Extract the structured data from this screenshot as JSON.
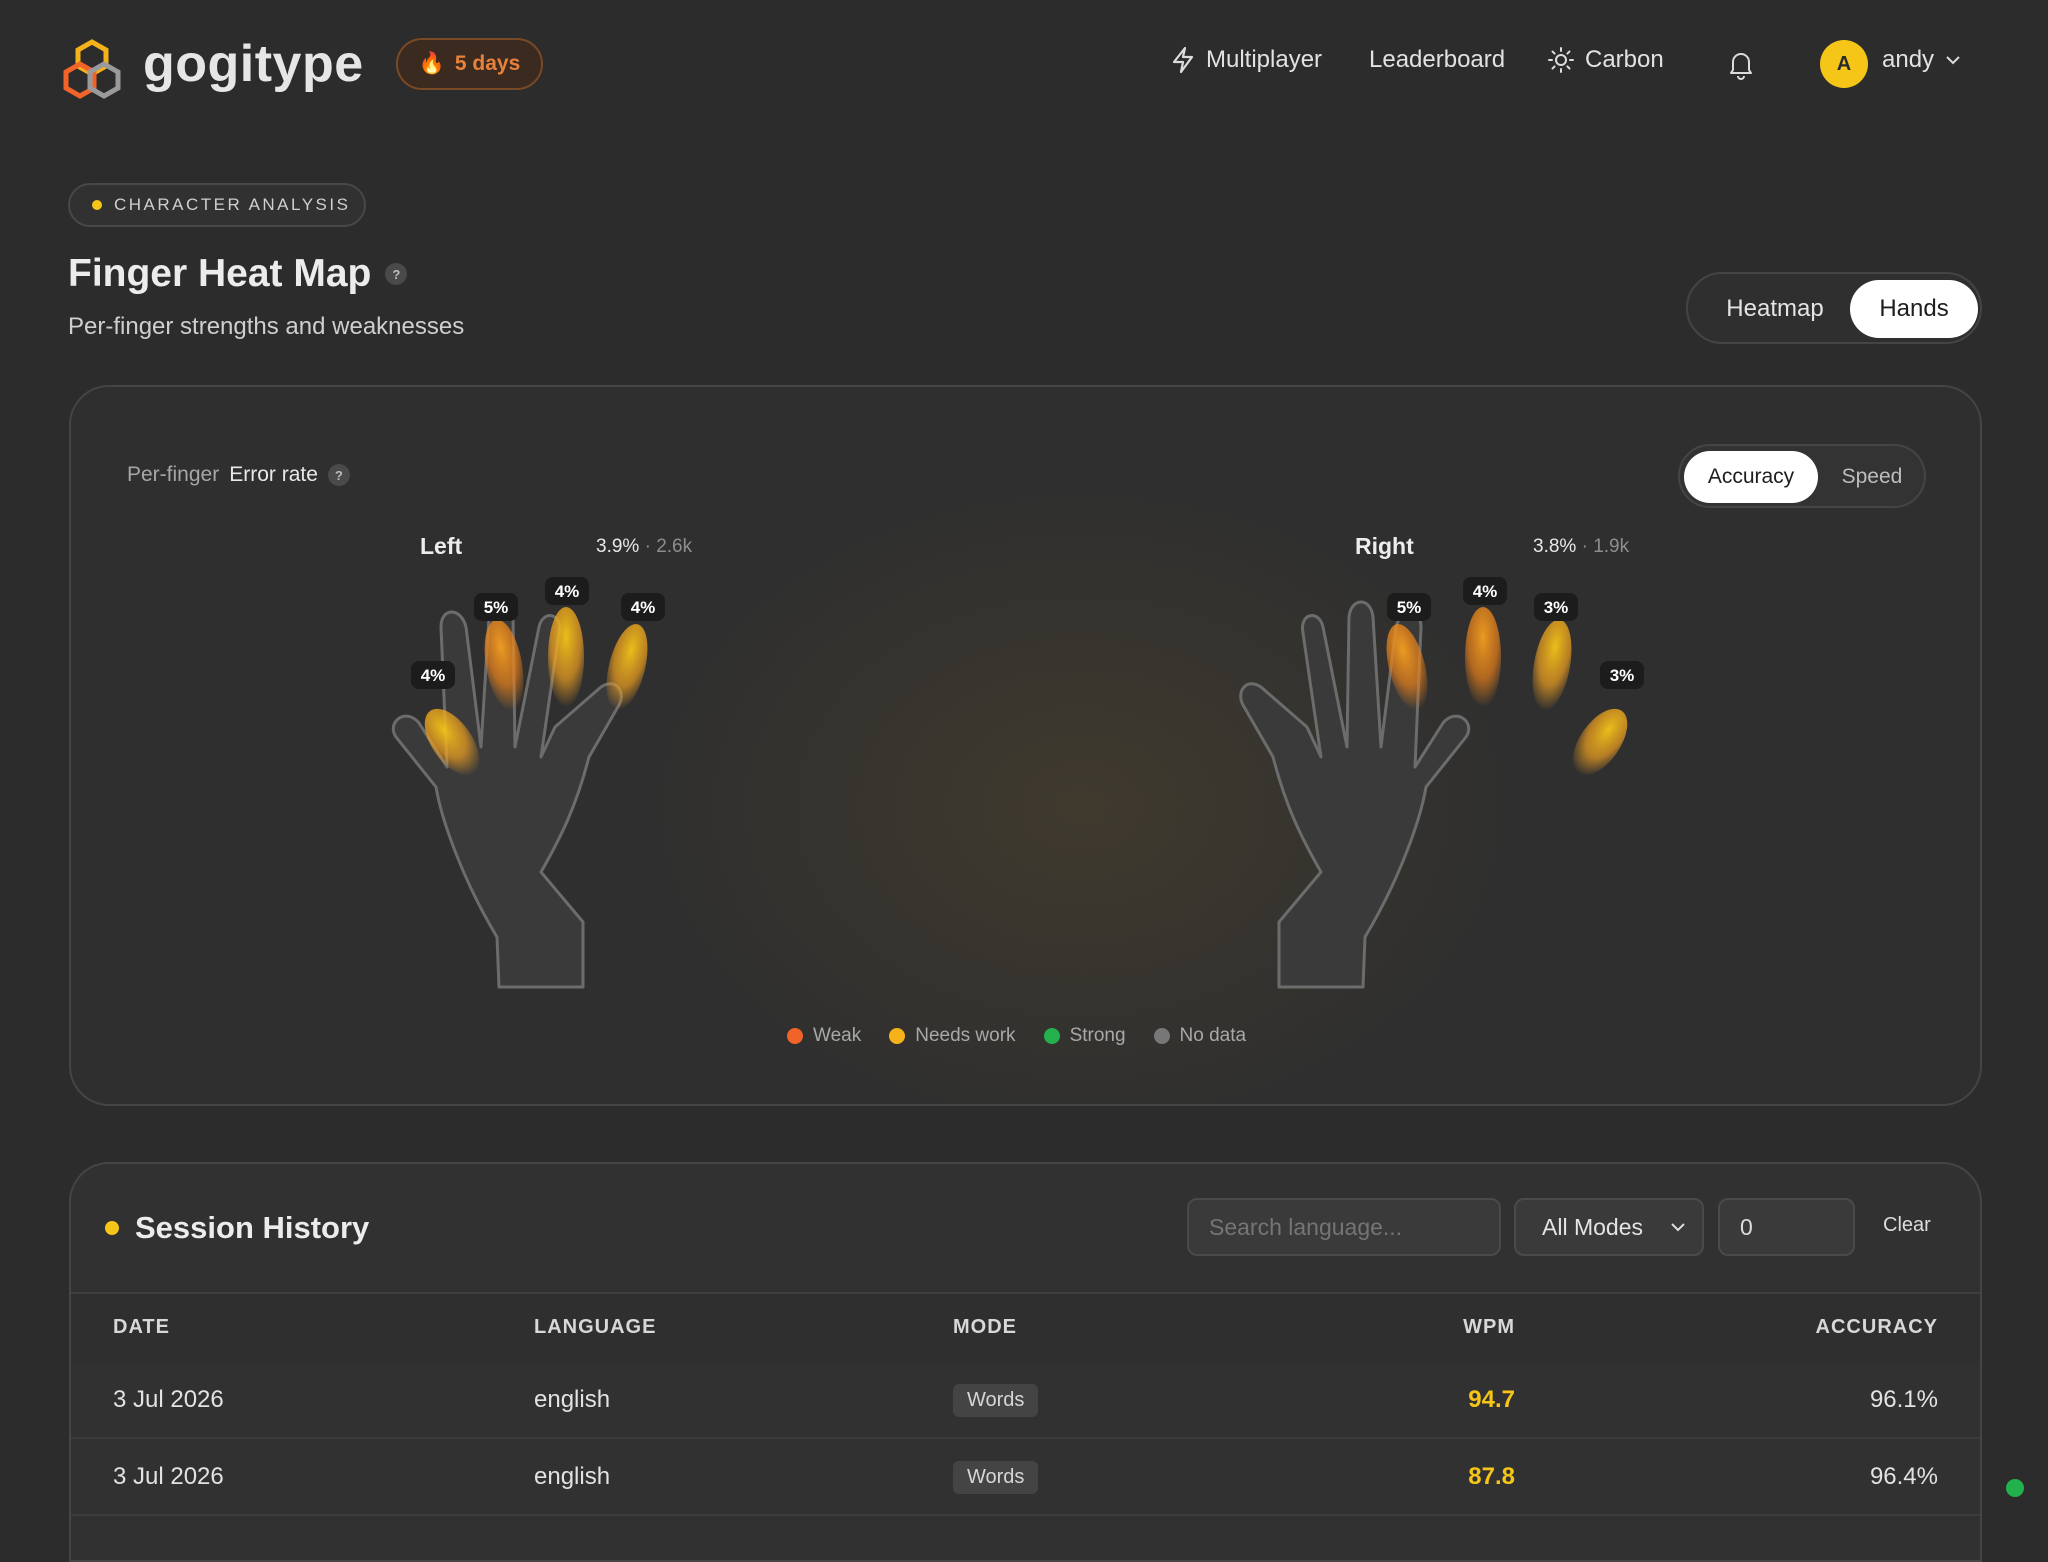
{
  "header": {
    "brand": "gogitype",
    "streak": "5 days",
    "nav": [
      {
        "label": "Multiplayer",
        "icon": "bolt-icon"
      },
      {
        "label": "Leaderboard"
      },
      {
        "label": "Carbon",
        "icon": "sun-icon"
      }
    ],
    "user": {
      "initial": "A",
      "name": "andy"
    }
  },
  "section_tag": "CHARACTER ANALYSIS",
  "page_title": "Finger Heat Map",
  "page_subtitle": "Per-finger strengths and weaknesses",
  "view_toggle": {
    "options": [
      "Heatmap",
      "Hands"
    ],
    "selected": "Hands"
  },
  "heatmap_card": {
    "label_prefix": "Per-finger",
    "label_metric": "Error rate",
    "metric_toggle": {
      "options": [
        "Accuracy",
        "Speed"
      ],
      "selected": "Accuracy"
    },
    "left": {
      "title": "Left",
      "rate": "3.9%",
      "count": "2.6k",
      "fingers": [
        "4%",
        "5%",
        "4%",
        "4%"
      ]
    },
    "right": {
      "title": "Right",
      "rate": "3.8%",
      "count": "1.9k",
      "fingers": [
        "5%",
        "4%",
        "3%",
        "3%"
      ]
    },
    "legend": [
      {
        "label": "Weak",
        "color": "#f0642a"
      },
      {
        "label": "Needs work",
        "color": "#f5b21a"
      },
      {
        "label": "Strong",
        "color": "#22b14c"
      },
      {
        "label": "No data",
        "color": "#777777"
      }
    ]
  },
  "session_history": {
    "title": "Session History",
    "search_placeholder": "Search language...",
    "mode_select": "All Modes",
    "number_value": "0",
    "clear_label": "Clear",
    "columns": [
      "DATE",
      "LANGUAGE",
      "MODE",
      "WPM",
      "ACCURACY"
    ],
    "rows": [
      {
        "date": "3 Jul 2026",
        "language": "english",
        "mode": "Words",
        "wpm": "94.7",
        "accuracy": "96.1%"
      },
      {
        "date": "3 Jul 2026",
        "language": "english",
        "mode": "Words",
        "wpm": "87.8",
        "accuracy": "96.4%"
      }
    ]
  }
}
